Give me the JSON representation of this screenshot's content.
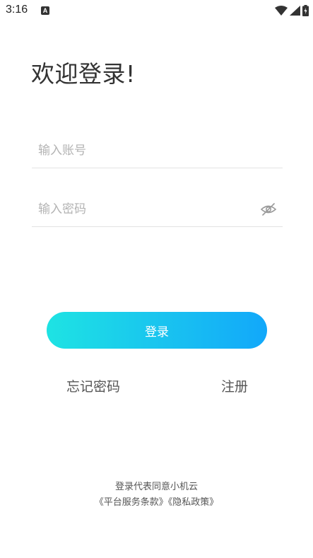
{
  "status_bar": {
    "time": "3:16",
    "notification_icon": "a-letter-icon",
    "wifi_icon": "wifi-icon",
    "signal_icon": "signal-icon",
    "battery_icon": "battery-charging-icon"
  },
  "title": "欢迎登录!",
  "form": {
    "account_placeholder": "输入账号",
    "password_placeholder": "输入密码",
    "password_toggle_icon": "eye-hidden-icon"
  },
  "login_button_label": "登录",
  "links": {
    "forgot_password": "忘记密码",
    "register": "注册"
  },
  "agreement": {
    "prefix": "登录代表同意小机云",
    "terms": "《平台服务条款》",
    "privacy": "《隐私政策》"
  },
  "colors": {
    "gradient_start": "#1ee3e3",
    "gradient_end": "#12a8fa",
    "placeholder": "#b3b3b3",
    "divider": "#e3e3e3"
  }
}
